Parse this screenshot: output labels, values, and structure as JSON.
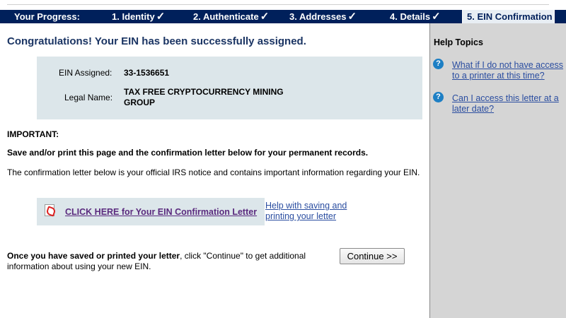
{
  "progress": {
    "label": "Your Progress:",
    "steps": [
      {
        "label": "1. Identity",
        "check": "✓"
      },
      {
        "label": "2. Authenticate",
        "check": "✓"
      },
      {
        "label": "3. Addresses",
        "check": "✓"
      },
      {
        "label": "4. Details",
        "check": "✓"
      },
      {
        "label": "5. EIN Confirmation"
      }
    ]
  },
  "main": {
    "congrats": "Congratulations! Your EIN has been successfully assigned.",
    "ein_label": "EIN Assigned:",
    "ein_value": "33-1536651",
    "legal_label": "Legal Name:",
    "legal_value_line1": "TAX FREE CRYPTOCURRENCY MINING",
    "legal_value_line2": "GROUP",
    "important": "IMPORTANT:",
    "save_line": "Save and/or print this page and the confirmation letter below for your permanent records.",
    "notice": "The confirmation letter below is your official IRS notice and contains important information regarding your EIN.",
    "letter_link": "CLICK HERE for Your EIN Confirmation Letter",
    "help_save_link": "Help with saving and printing your letter",
    "continue_bold": "Once you have saved or printed your letter",
    "continue_rest": ", click \"Continue\" to get additional information about using your new EIN.",
    "continue_button": "Continue >>"
  },
  "sidebar": {
    "title": "Help Topics",
    "items": [
      {
        "icon": "question-icon",
        "label": "What if I do not have access to a printer at this time?"
      },
      {
        "icon": "question-icon",
        "label": "Can I access this letter at a later date?"
      }
    ]
  },
  "colors": {
    "progress_bg": "#00205b",
    "panel_bg": "#dce6ea",
    "sidebar_bg": "#d5d5d5",
    "heading": "#1a3463",
    "link": "#2a4da0",
    "visited_link": "#5a2a7e"
  }
}
